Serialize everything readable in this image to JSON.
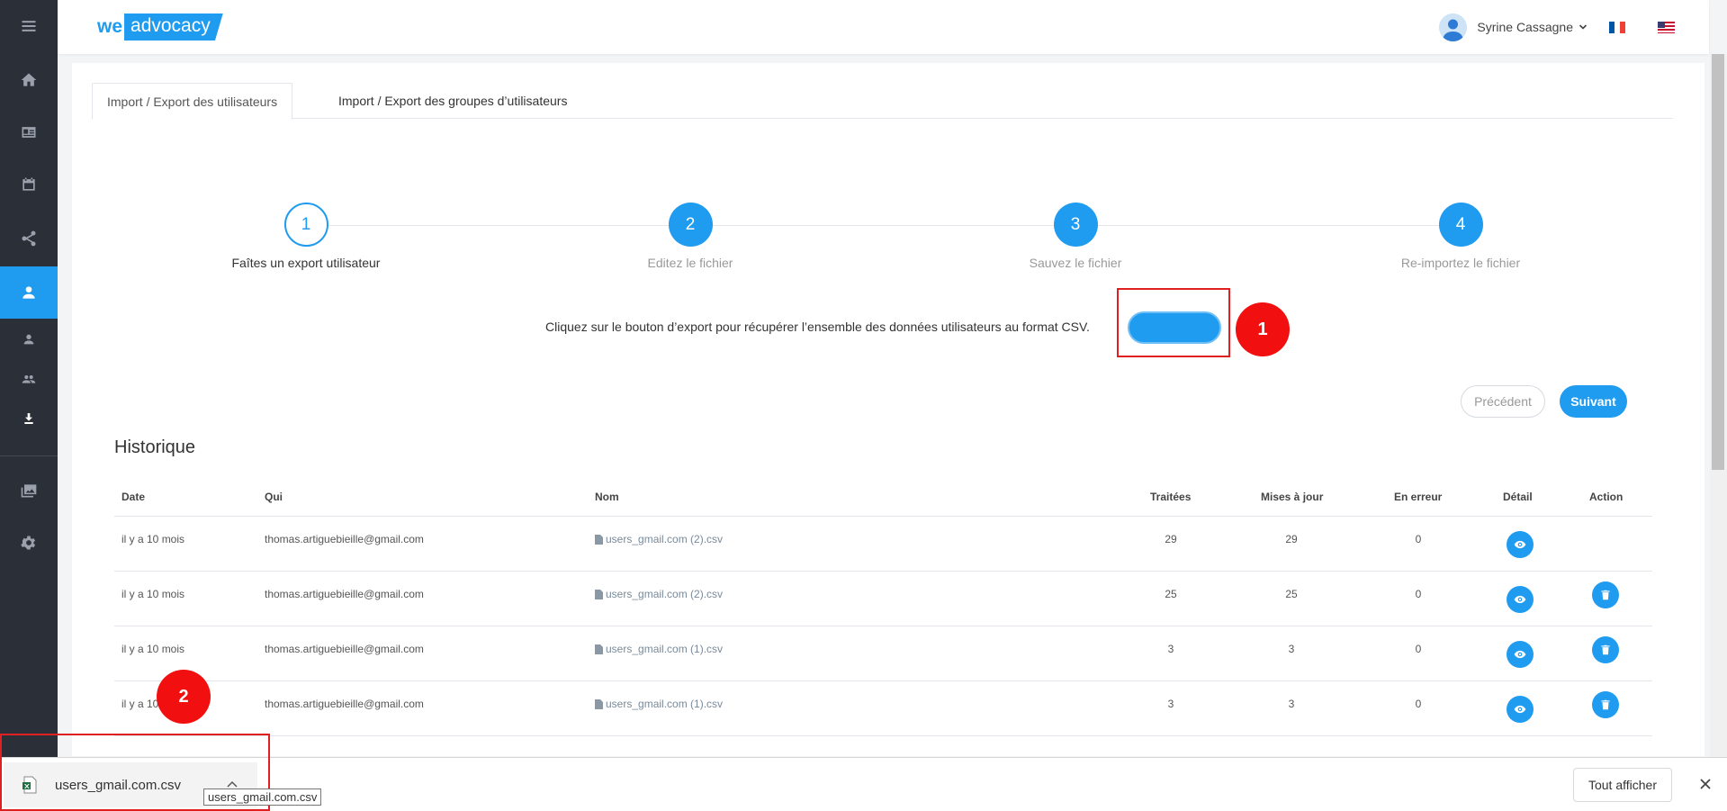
{
  "app": {
    "logo_we": "we",
    "logo_brand": "advocacy"
  },
  "header": {
    "user_name": "Syrine Cassagne"
  },
  "tabs": [
    {
      "label": "Import / Export des utilisateurs",
      "active": true
    },
    {
      "label": "Import / Export des groupes d’utilisateurs",
      "active": false
    }
  ],
  "stepper": [
    {
      "number": "1",
      "label": "Faîtes un export utilisateur"
    },
    {
      "number": "2",
      "label": "Editez le fichier"
    },
    {
      "number": "3",
      "label": "Sauvez le fichier"
    },
    {
      "number": "4",
      "label": "Re-importez le fichier"
    }
  ],
  "export": {
    "instruction": "Cliquez sur le bouton d’export pour récupérer l’ensemble des données utilisateurs au format CSV."
  },
  "annotations": {
    "badge1": "1",
    "badge2": "2"
  },
  "nav": {
    "prev_label": "Précédent",
    "next_label": "Suivant"
  },
  "history": {
    "title": "Historique",
    "columns": [
      "Date",
      "Qui",
      "Nom",
      "Traitées",
      "Mises à jour",
      "En erreur",
      "Détail",
      "Action"
    ],
    "rows": [
      {
        "date": "il y a 10 mois",
        "who": "thomas.artiguebieille@gmail.com",
        "name": "users_gmail.com (2).csv",
        "treated": "29",
        "updated": "29",
        "errors": "0",
        "has_delete": false
      },
      {
        "date": "il y a 10 mois",
        "who": "thomas.artiguebieille@gmail.com",
        "name": "users_gmail.com (2).csv",
        "treated": "25",
        "updated": "25",
        "errors": "0",
        "has_delete": true
      },
      {
        "date": "il y a 10 mois",
        "who": "thomas.artiguebieille@gmail.com",
        "name": "users_gmail.com (1).csv",
        "treated": "3",
        "updated": "3",
        "errors": "0",
        "has_delete": true
      },
      {
        "date": "il y a 10",
        "who": "thomas.artiguebieille@gmail.com",
        "name": "users_gmail.com (1).csv",
        "treated": "3",
        "updated": "3",
        "errors": "0",
        "has_delete": true
      }
    ]
  },
  "downloads": {
    "file_name": "users_gmail.com.csv",
    "tooltip": "users_gmail.com.csv",
    "show_all_label": "Tout afficher"
  },
  "colors": {
    "accent": "#1f9bf0",
    "sidebar_bg": "#2b2f38",
    "annotation_red": "#f20f0f"
  }
}
